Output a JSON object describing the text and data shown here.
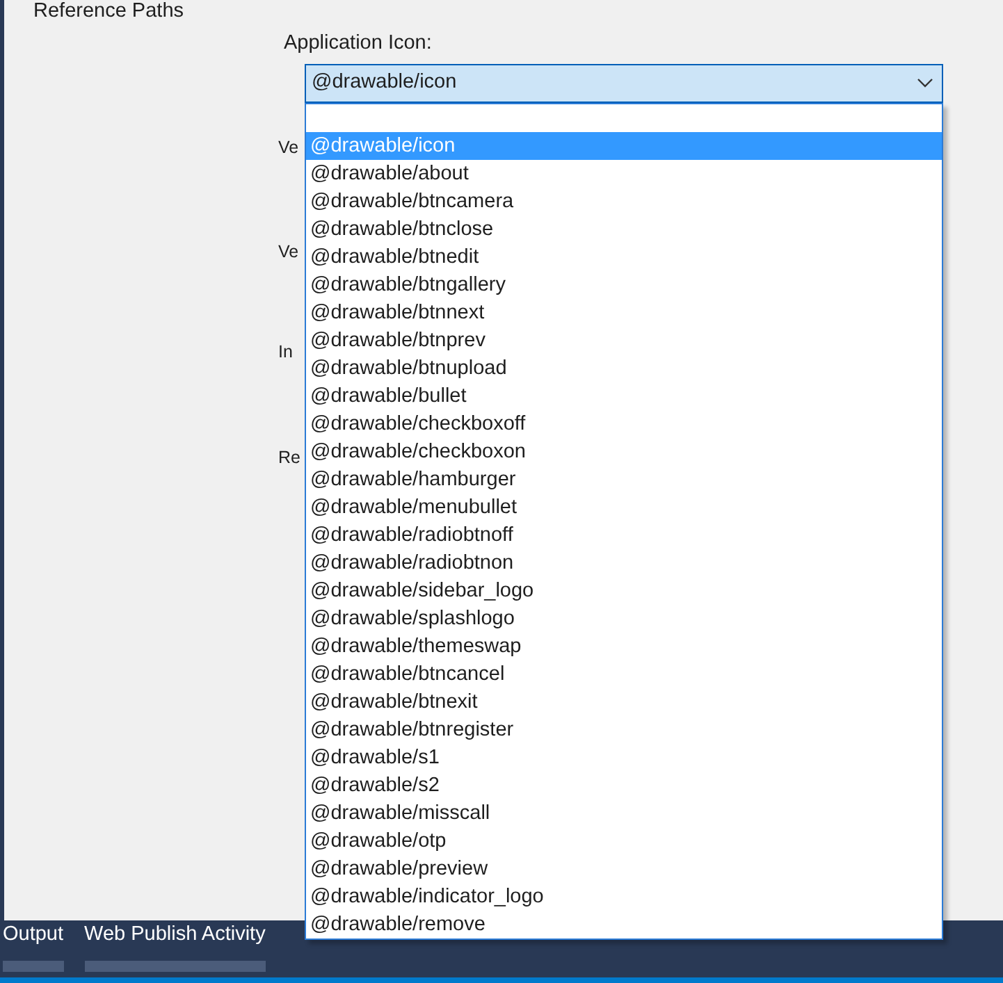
{
  "sidebar": {
    "items": [
      {
        "label": "Reference Paths"
      }
    ]
  },
  "form": {
    "label": "Application Icon:",
    "value": "@drawable/icon",
    "hidden_labels": [
      "Ve",
      "Ve",
      "In",
      "Re"
    ]
  },
  "dropdown": {
    "expanded": true,
    "items": [
      {
        "label": "@drawable/icon",
        "selected": true
      },
      {
        "label": "@drawable/about",
        "selected": false
      },
      {
        "label": "@drawable/btncamera",
        "selected": false
      },
      {
        "label": "@drawable/btnclose",
        "selected": false
      },
      {
        "label": "@drawable/btnedit",
        "selected": false
      },
      {
        "label": "@drawable/btngallery",
        "selected": false
      },
      {
        "label": "@drawable/btnnext",
        "selected": false
      },
      {
        "label": "@drawable/btnprev",
        "selected": false
      },
      {
        "label": "@drawable/btnupload",
        "selected": false
      },
      {
        "label": "@drawable/bullet",
        "selected": false
      },
      {
        "label": "@drawable/checkboxoff",
        "selected": false
      },
      {
        "label": "@drawable/checkboxon",
        "selected": false
      },
      {
        "label": "@drawable/hamburger",
        "selected": false
      },
      {
        "label": "@drawable/menubullet",
        "selected": false
      },
      {
        "label": "@drawable/radiobtnoff",
        "selected": false
      },
      {
        "label": "@drawable/radiobtnon",
        "selected": false
      },
      {
        "label": "@drawable/sidebar_logo",
        "selected": false
      },
      {
        "label": "@drawable/splashlogo",
        "selected": false
      },
      {
        "label": "@drawable/themeswap",
        "selected": false
      },
      {
        "label": "@drawable/btncancel",
        "selected": false
      },
      {
        "label": "@drawable/btnexit",
        "selected": false
      },
      {
        "label": "@drawable/btnregister",
        "selected": false
      },
      {
        "label": "@drawable/s1",
        "selected": false
      },
      {
        "label": "@drawable/s2",
        "selected": false
      },
      {
        "label": "@drawable/misscall",
        "selected": false
      },
      {
        "label": "@drawable/otp",
        "selected": false
      },
      {
        "label": "@drawable/preview",
        "selected": false
      },
      {
        "label": "@drawable/indicator_logo",
        "selected": false
      },
      {
        "label": "@drawable/remove",
        "selected": false
      }
    ]
  },
  "bottom_tabs": [
    {
      "label": "Output"
    },
    {
      "label": "Web Publish Activity"
    }
  ]
}
